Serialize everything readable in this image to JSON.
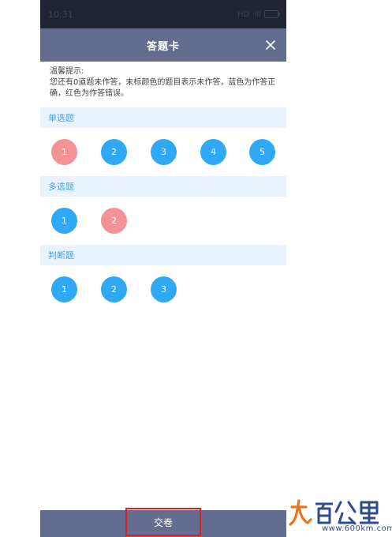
{
  "status_bar": {
    "time": "10:31",
    "indicators": "HD ·ıll"
  },
  "header": {
    "title": "答题卡",
    "close_icon": "close-icon"
  },
  "tip": {
    "line1": "温馨提示:",
    "line2": "您还有0道题未作答，未标颜色的题目表示未作答，蓝色为作答正确，红色为作答错误。"
  },
  "sections": [
    {
      "title": "单选题",
      "questions": [
        {
          "num": "1",
          "status": "wrong"
        },
        {
          "num": "2",
          "status": "correct"
        },
        {
          "num": "3",
          "status": "correct"
        },
        {
          "num": "4",
          "status": "correct"
        },
        {
          "num": "5",
          "status": "correct"
        }
      ]
    },
    {
      "title": "多选题",
      "questions": [
        {
          "num": "1",
          "status": "correct"
        },
        {
          "num": "2",
          "status": "wrong"
        }
      ]
    },
    {
      "title": "判断题",
      "questions": [
        {
          "num": "1",
          "status": "correct"
        },
        {
          "num": "2",
          "status": "correct"
        },
        {
          "num": "3",
          "status": "correct"
        }
      ]
    }
  ],
  "footer": {
    "submit_label": "交卷"
  },
  "watermark": {
    "url": "www.600km.com"
  },
  "colors": {
    "correct": "#2fa8f5",
    "wrong": "#f39395",
    "header": "#646c8f",
    "section_bg": "#eaf3fd",
    "section_text": "#4aa1e8",
    "submit_highlight": "#e01f1f"
  }
}
